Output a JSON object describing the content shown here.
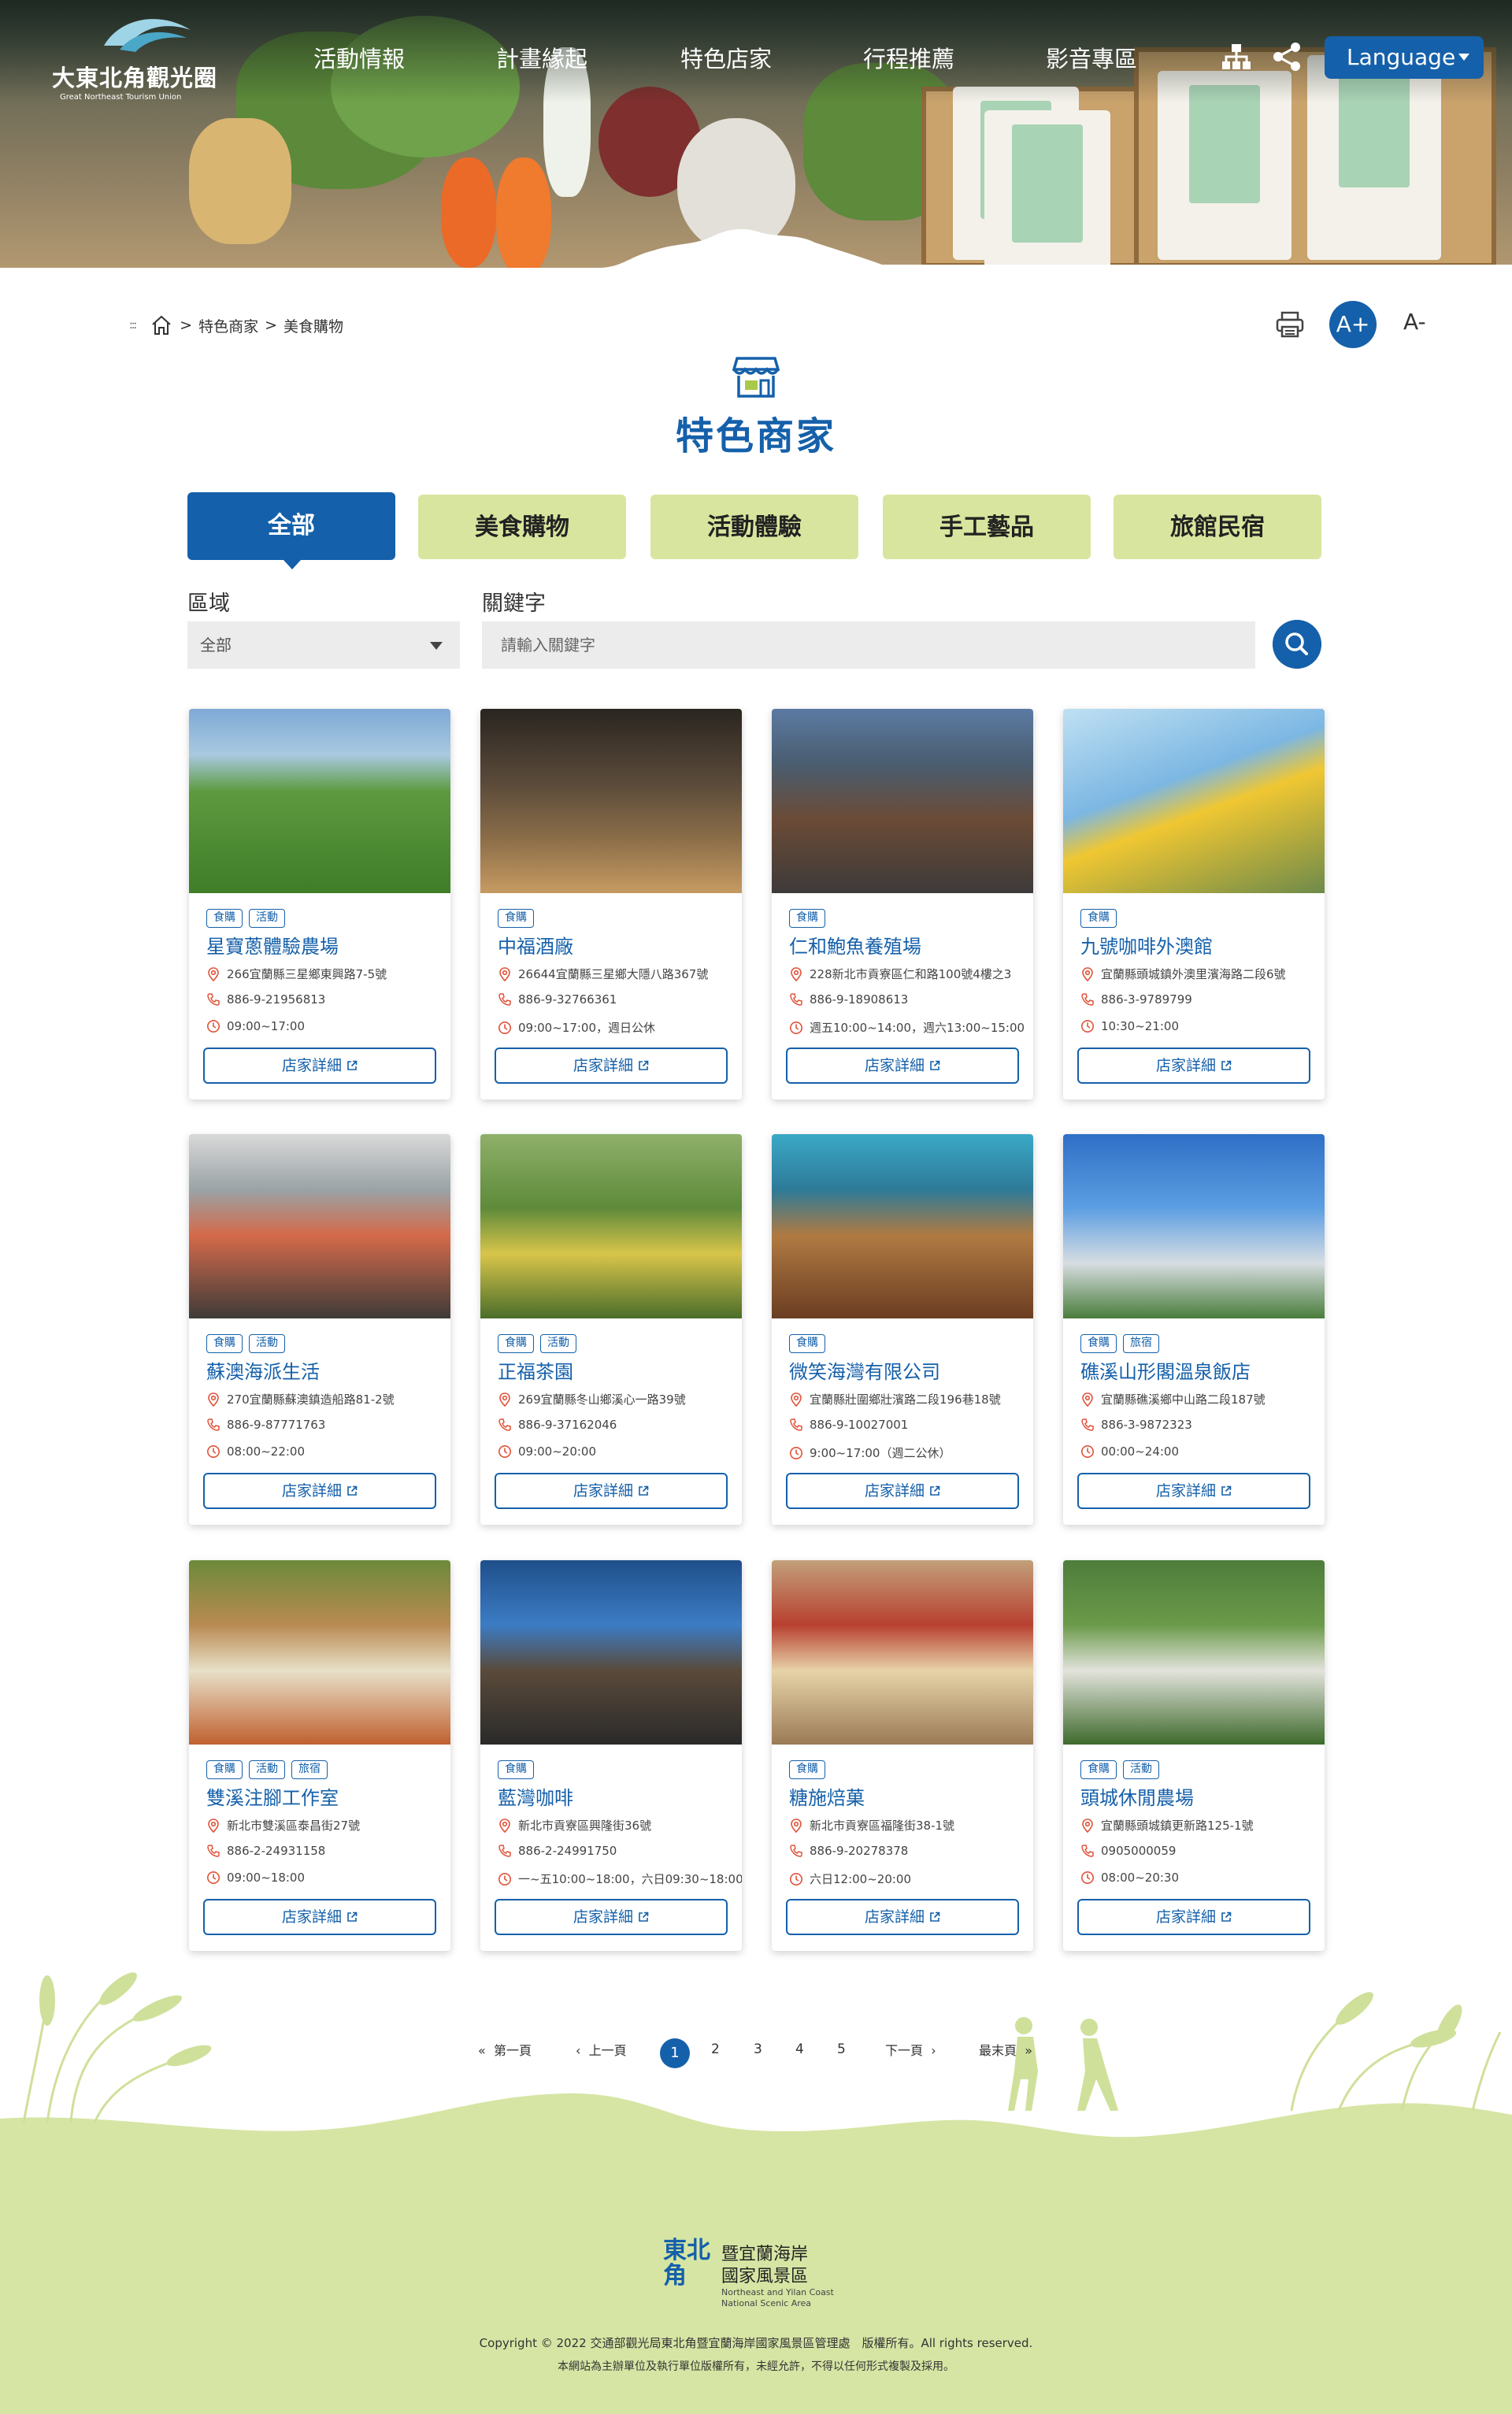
{
  "site": {
    "logo_title": "大東北角觀光圈",
    "logo_subtitle": "Great Northeast Tourism Union"
  },
  "nav": [
    "活動情報",
    "計畫緣起",
    "特色店家",
    "行程推薦",
    "影音專區"
  ],
  "language_label": "Language",
  "breadcrumb": [
    "特色商家",
    "美食購物"
  ],
  "breadcrumb_sep": ">",
  "font_up_label": "A+",
  "font_down_label": "A-",
  "page_title": "特色商家",
  "tabs": [
    "全部",
    "美食購物",
    "活動體驗",
    "手工藝品",
    "旅館民宿"
  ],
  "filters": {
    "area_label": "區域",
    "area_value": "全部",
    "keyword_label": "關鍵字",
    "keyword_placeholder": "請輸入關鍵字"
  },
  "detail_label": "店家詳細",
  "stores": [
    {
      "name": "星寶蔥體驗農場",
      "tags": [
        "食購",
        "活動"
      ],
      "address": "266宜蘭縣三星鄉東興路7-5號",
      "phone": "886-9-21956813",
      "hours": "09:00~17:00"
    },
    {
      "name": "中福酒廠",
      "tags": [
        "食購"
      ],
      "address": "26644宜蘭縣三星鄉大隱八路367號",
      "phone": "886-9-32766361",
      "hours": "09:00~17:00，週日公休"
    },
    {
      "name": "仁和鮑魚養殖場",
      "tags": [
        "食購"
      ],
      "address": "228新北市貢寮區仁和路100號4樓之3",
      "phone": "886-9-18908613",
      "hours": "週五10:00~14:00，週六13:00~15:00"
    },
    {
      "name": "九號咖啡外澳館",
      "tags": [
        "食購"
      ],
      "address": "宜蘭縣頭城鎮外澳里濱海路二段6號",
      "phone": "886-3-9789799",
      "hours": "10:30~21:00"
    },
    {
      "name": "蘇澳海派生活",
      "tags": [
        "食購",
        "活動"
      ],
      "address": "270宜蘭縣蘇澳鎮造船路81-2號",
      "phone": "886-9-87771763",
      "hours": "08:00~22:00"
    },
    {
      "name": "正福茶園",
      "tags": [
        "食購",
        "活動"
      ],
      "address": "269宜蘭縣冬山鄉溪心一路39號",
      "phone": "886-9-37162046",
      "hours": "09:00~20:00"
    },
    {
      "name": "微笑海灣有限公司",
      "tags": [
        "食購"
      ],
      "address": "宜蘭縣壯圍鄉壯濱路二段196巷18號",
      "phone": "886-9-10027001",
      "hours": "9:00~17:00（週二公休）"
    },
    {
      "name": "礁溪山形閣溫泉飯店",
      "tags": [
        "食購",
        "旅宿"
      ],
      "address": "宜蘭縣礁溪鄉中山路二段187號",
      "phone": "886-3-9872323",
      "hours": "00:00~24:00"
    },
    {
      "name": "雙溪注腳工作室",
      "tags": [
        "食購",
        "活動",
        "旅宿"
      ],
      "address": "新北市雙溪區泰昌街27號",
      "phone": "886-2-24931158",
      "hours": "09:00~18:00"
    },
    {
      "name": "藍灣咖啡",
      "tags": [
        "食購"
      ],
      "address": "新北市貢寮區興隆街36號",
      "phone": "886-2-24991750",
      "hours": "一~五10:00~18:00，六日09:30~18:00"
    },
    {
      "name": "糖施焙菓",
      "tags": [
        "食購"
      ],
      "address": "新北市貢寮區福隆街38-1號",
      "phone": "886-9-20278378",
      "hours": "六日12:00~20:00"
    },
    {
      "name": "頭城休閒農場",
      "tags": [
        "食購",
        "活動"
      ],
      "address": "宜蘭縣頭城鎮更新路125-1號",
      "phone": "0905000059",
      "hours": "08:00~20:30"
    }
  ],
  "pagination": {
    "first": "第一頁",
    "prev": "上一頁",
    "pages": [
      "1",
      "2",
      "3",
      "4",
      "5"
    ],
    "current": "1",
    "next": "下一頁",
    "last": "最末頁"
  },
  "footer": {
    "org_name_line1": "暨宜蘭海岸",
    "org_name_line2": "國家風景區",
    "org_en_line1": "Northeast and Yilan Coast",
    "org_en_line2": "National Scenic Area",
    "logo_glyphs": "東北角",
    "copyright": "Copyright © 2022 交通部觀光局東北角暨宜蘭海岸國家風景區管理處　版權所有。All rights reserved.",
    "notice": "本網站為主辦單位及執行單位版權所有，未經允許，不得以任何形式複製及採用。"
  },
  "colors": {
    "primary": "#1560aa",
    "tab_bg": "#d8e59e",
    "footer_green": "#d6e5a4"
  }
}
